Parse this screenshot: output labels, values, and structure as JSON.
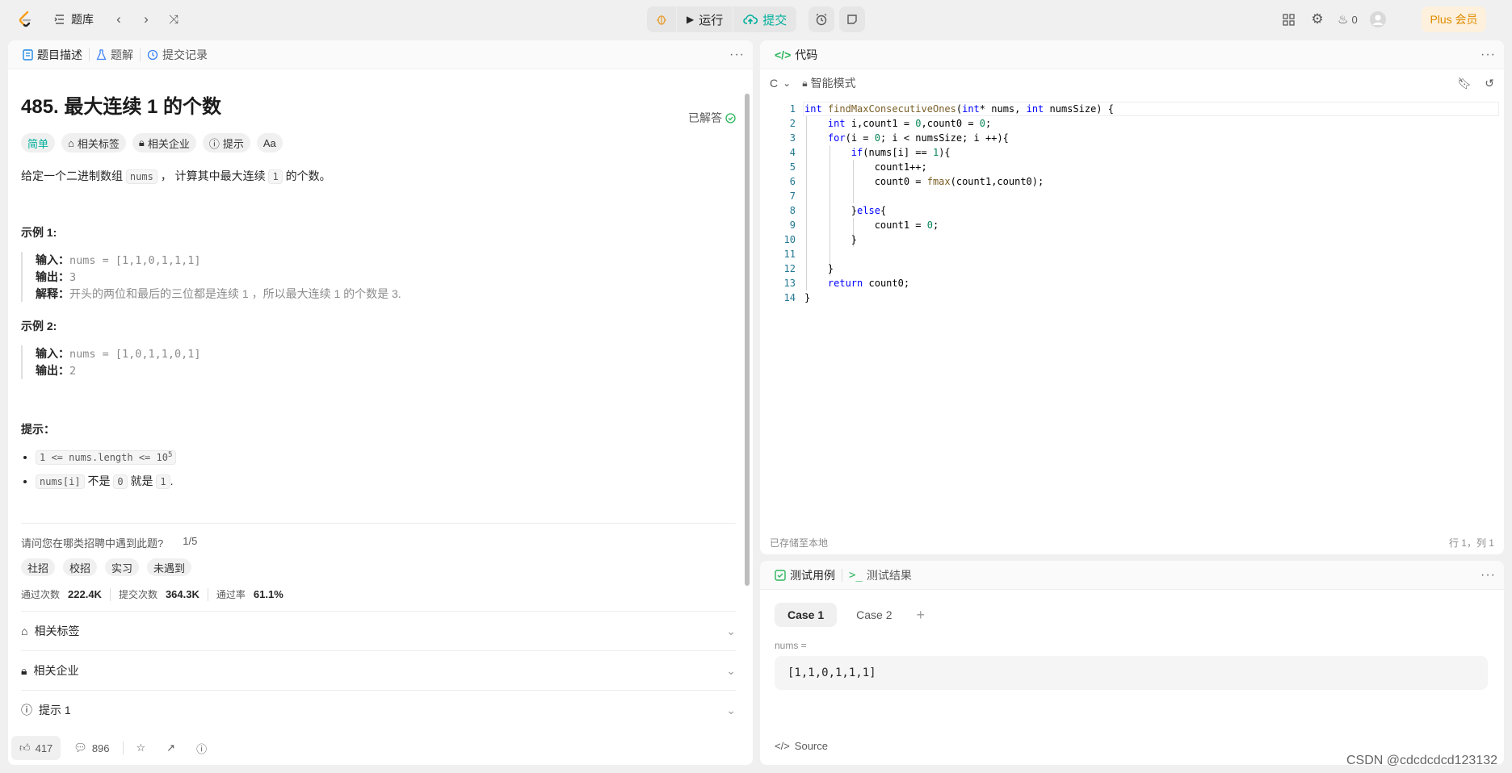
{
  "topbar": {
    "bank_label": "题库",
    "run_label": "运行",
    "submit_label": "提交",
    "streak_count": "0",
    "plus_label": "Plus 会员"
  },
  "left": {
    "tabs": [
      {
        "label": "题目描述"
      },
      {
        "label": "题解"
      },
      {
        "label": "提交记录"
      }
    ],
    "title": "485. 最大连续 1 的个数",
    "solved_label": "已解答",
    "tags": [
      "简单",
      "相关标签",
      "相关企业",
      "提示",
      "Aa"
    ],
    "desc_prefix": "给定一个二进制数组",
    "desc_code1": "nums",
    "desc_mid": "， 计算其中最大连续",
    "desc_code2": "1",
    "desc_suffix": "的个数。",
    "example1_title": "示例 1:",
    "example1_in_label": "输入：",
    "example1_in": "nums = [1,1,0,1,1,1]",
    "example1_out_label": "输出：",
    "example1_out": "3",
    "example1_exp_label": "解释：",
    "example1_exp": "开头的两位和最后的三位都是连续 1 ，所以最大连续 1 的个数是 3.",
    "example2_title": "示例 2:",
    "example2_in_label": "输入：",
    "example2_in": "nums = [1,0,1,1,0,1]",
    "example2_out_label": "输出：",
    "example2_out": "2",
    "hints_title": "提示：",
    "hint1_code": "1 <= nums.length <= 10",
    "hint1_sup": "5",
    "hint2_code1": "nums[i]",
    "hint2_mid": "不是",
    "hint2_code2": "0",
    "hint2_mid2": "就是",
    "hint2_code3": "1",
    "hint2_end": ".",
    "survey_q": "请问您在哪类招聘中遇到此题?",
    "survey_page": "1/5",
    "survey_chips": [
      "社招",
      "校招",
      "实习",
      "未遇到"
    ],
    "stats": [
      {
        "label": "通过次数",
        "value": "222.4K"
      },
      {
        "label": "提交次数",
        "value": "364.3K"
      },
      {
        "label": "通过率",
        "value": "61.1%"
      }
    ],
    "accordions": [
      "相关标签",
      "相关企业",
      "提示 1"
    ],
    "likes": "417",
    "comments": "896"
  },
  "editor": {
    "tab_label": "代码",
    "lang": "C",
    "mode": "智能模式",
    "saved": "已存储至本地",
    "position": "行 1，列 1",
    "line_numbers": [
      "1",
      "2",
      "3",
      "4",
      "5",
      "6",
      "7",
      "8",
      "9",
      "10",
      "11",
      "12",
      "13",
      "14"
    ]
  },
  "tests": {
    "tab1": "测试用例",
    "tab2": "测试结果",
    "cases": [
      "Case 1",
      "Case 2"
    ],
    "var_label": "nums =",
    "var_value": "[1,1,0,1,1,1]",
    "source_label": "Source",
    "watermark": "CSDN @cdcdcdcd123132"
  }
}
